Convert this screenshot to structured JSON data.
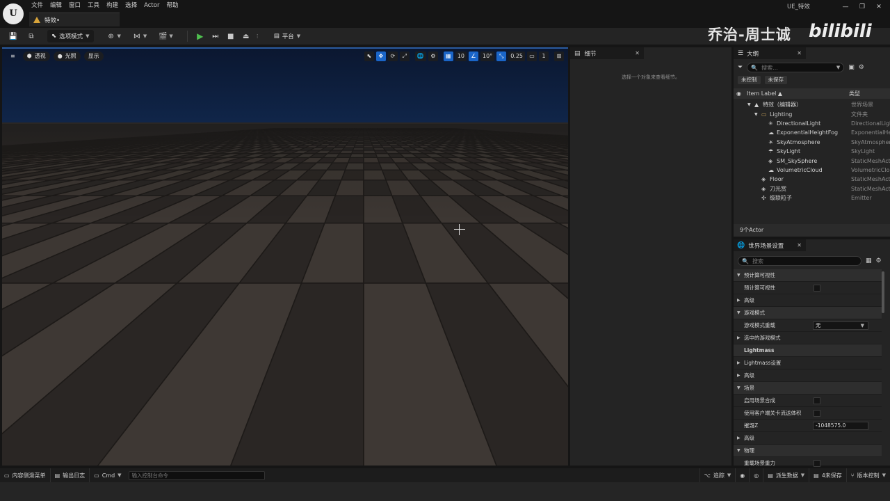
{
  "titlebar": {
    "logo": "U",
    "menu": [
      "文件",
      "编辑",
      "窗口",
      "工具",
      "构建",
      "选择",
      "Actor",
      "帮助"
    ],
    "doc_tab": "特效•",
    "project_name": "UE_特效",
    "win_min": "—",
    "win_max": "❐",
    "win_close": "✕"
  },
  "watermark": {
    "text": "乔治-周士诚",
    "logo": "bilibili"
  },
  "toolbar": {
    "save_icon": "💾",
    "browse_icon": "⧉",
    "mode_label": "选项模式",
    "add_icon": "⊕",
    "blueprint_icon": "⋈",
    "cinematic_icon": "🎬",
    "play_icon": "▶",
    "step_icon": "⏭",
    "stop_icon": "■",
    "eject_icon": "⏏",
    "platform_icon": "▤",
    "platform_label": "平台"
  },
  "viewport": {
    "menu_icon": "≡",
    "perspective": "透视",
    "lighting": "光照",
    "show": "显示",
    "grid_snap": "10",
    "rot_snap": "10°",
    "scale_snap": "0.25",
    "camera_speed": "1",
    "sky_top": "#0b1730",
    "sky_bottom": "#10264a",
    "floor_light": "#3e3834",
    "floor_dark": "#2a2624",
    "selection_border": "#2a5a9f"
  },
  "details": {
    "tab_label": "细节",
    "close": "✕",
    "empty_text": "选择一个对象来查看细节。"
  },
  "outliner": {
    "tab_label": "大纲",
    "close": "✕",
    "search_placeholder": "搜索...",
    "pill_unsaved_ctrl": "未控制",
    "pill_unsaved": "未保存",
    "col_label": "Item Label ▲",
    "col_type": "类型",
    "rows": [
      {
        "indent": 0,
        "arrow": "▼",
        "icon": "▲",
        "label": "特效（编辑器）",
        "type": "世界场景"
      },
      {
        "indent": 1,
        "arrow": "▼",
        "icon": "▭",
        "label": "Lighting",
        "type": "文件夹"
      },
      {
        "indent": 2,
        "arrow": "",
        "icon": "✳",
        "label": "DirectionalLight",
        "type": "DirectionalLight"
      },
      {
        "indent": 2,
        "arrow": "",
        "icon": "☁",
        "label": "ExponentialHeightFog",
        "type": "ExponentialHeightFog"
      },
      {
        "indent": 2,
        "arrow": "",
        "icon": "☀",
        "label": "SkyAtmosphere",
        "type": "SkyAtmosphere"
      },
      {
        "indent": 2,
        "arrow": "",
        "icon": "☂",
        "label": "SkyLight",
        "type": "SkyLight"
      },
      {
        "indent": 2,
        "arrow": "",
        "icon": "◈",
        "label": "SM_SkySphere",
        "type": "StaticMeshActor"
      },
      {
        "indent": 2,
        "arrow": "",
        "icon": "☁",
        "label": "VolumetricCloud",
        "type": "VolumetricCloud"
      },
      {
        "indent": 1,
        "arrow": "",
        "icon": "◈",
        "label": "Floor",
        "type": "StaticMeshActor"
      },
      {
        "indent": 1,
        "arrow": "",
        "icon": "◈",
        "label": "刀光赏",
        "type": "StaticMeshActor"
      },
      {
        "indent": 1,
        "arrow": "",
        "icon": "✣",
        "label": "级联粒子",
        "type": "Emitter"
      }
    ],
    "actor_count": "9个Actor"
  },
  "world_settings": {
    "tab_label": "世界场景设置",
    "close": "✕",
    "search_placeholder": "搜索",
    "rows": [
      {
        "kind": "cat",
        "arrow": "▼",
        "label": "预计算可视性"
      },
      {
        "kind": "check",
        "arrow": "",
        "label": "预计算可视性"
      },
      {
        "kind": "sub",
        "arrow": "▶",
        "label": "高级"
      },
      {
        "kind": "cat",
        "arrow": "▼",
        "label": "游戏模式"
      },
      {
        "kind": "select",
        "arrow": "",
        "label": "游戏模式重载",
        "value": "无"
      },
      {
        "kind": "sub",
        "arrow": "▶",
        "label": "选中的游戏模式"
      },
      {
        "kind": "catbold",
        "arrow": "",
        "label": "Lightmass"
      },
      {
        "kind": "sub",
        "arrow": "▶",
        "label": "Lightmass设置"
      },
      {
        "kind": "sub",
        "arrow": "▶",
        "label": "高级"
      },
      {
        "kind": "cat",
        "arrow": "▼",
        "label": "场景"
      },
      {
        "kind": "check",
        "arrow": "",
        "label": "启用场景合成"
      },
      {
        "kind": "check",
        "arrow": "",
        "label": "使用客户端关卡流送体积"
      },
      {
        "kind": "field",
        "arrow": "",
        "label": "摧毁Z",
        "value": "-1048575.0"
      },
      {
        "kind": "sub",
        "arrow": "▶",
        "label": "高级"
      },
      {
        "kind": "cat",
        "arrow": "▼",
        "label": "物理"
      },
      {
        "kind": "check",
        "arrow": "",
        "label": "重载场景重力"
      }
    ]
  },
  "statusbar": {
    "content_drawer": "内容侧滑菜单",
    "output_log": "输出日志",
    "cmd": "Cmd",
    "console_placeholder": "输入控制台命令",
    "trace": "追踪",
    "derived_data": "派生数据",
    "unsaved": "4未保存",
    "source_control": "版本控制"
  }
}
